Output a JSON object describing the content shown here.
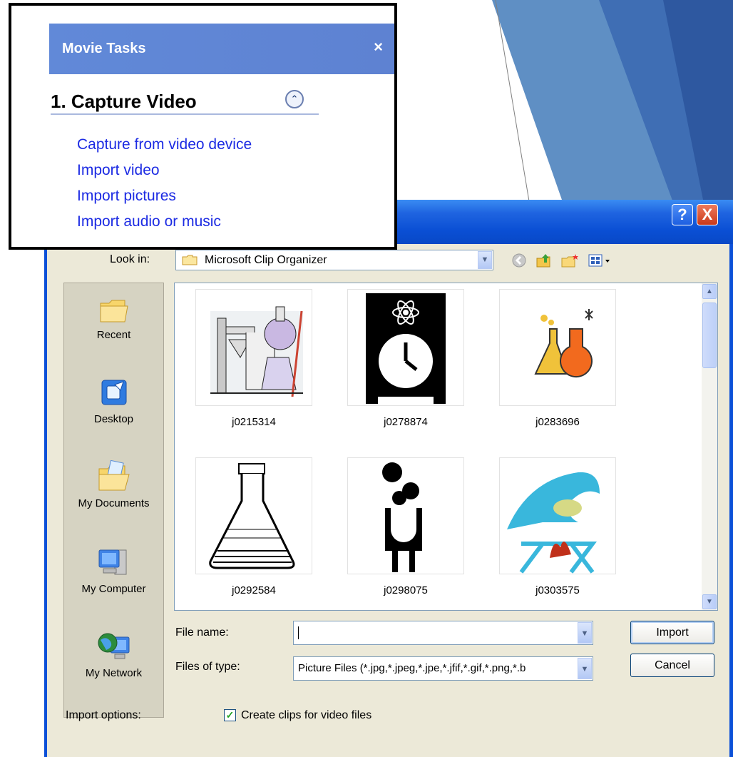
{
  "tasks_panel": {
    "header": "Movie Tasks",
    "close_glyph": "×",
    "section_title": "1. Capture Video",
    "collapse_glyph": "⌃",
    "links": [
      "Capture from video device",
      "Import video",
      "Import pictures",
      "Import audio or music"
    ]
  },
  "dialog": {
    "help_glyph": "?",
    "close_glyph": "X",
    "look_in_label": "Look in:",
    "look_in_value": "Microsoft Clip Organizer",
    "places": [
      "Recent",
      "Desktop",
      "My Documents",
      "My Computer",
      "My Network"
    ],
    "files": [
      "j0215314",
      "j0278874",
      "j0283696",
      "j0292584",
      "j0298075",
      "j0303575"
    ],
    "file_name_label": "File name:",
    "file_name_value": "",
    "files_of_type_label": "Files of type:",
    "files_of_type_value": "Picture Files (*.jpg,*.jpeg,*.jpe,*.jfif,*.gif,*.png,*.b",
    "import_button": "Import",
    "cancel_button": "Cancel",
    "import_options_label": "Import options:",
    "create_clips_label": "Create clips for video files",
    "create_clips_checked": true
  },
  "colors": {
    "dialog_frame": "#0b50d8",
    "task_header": "#6189d8",
    "link": "#1c2be3",
    "slide_blue": "#3f6fb3"
  }
}
